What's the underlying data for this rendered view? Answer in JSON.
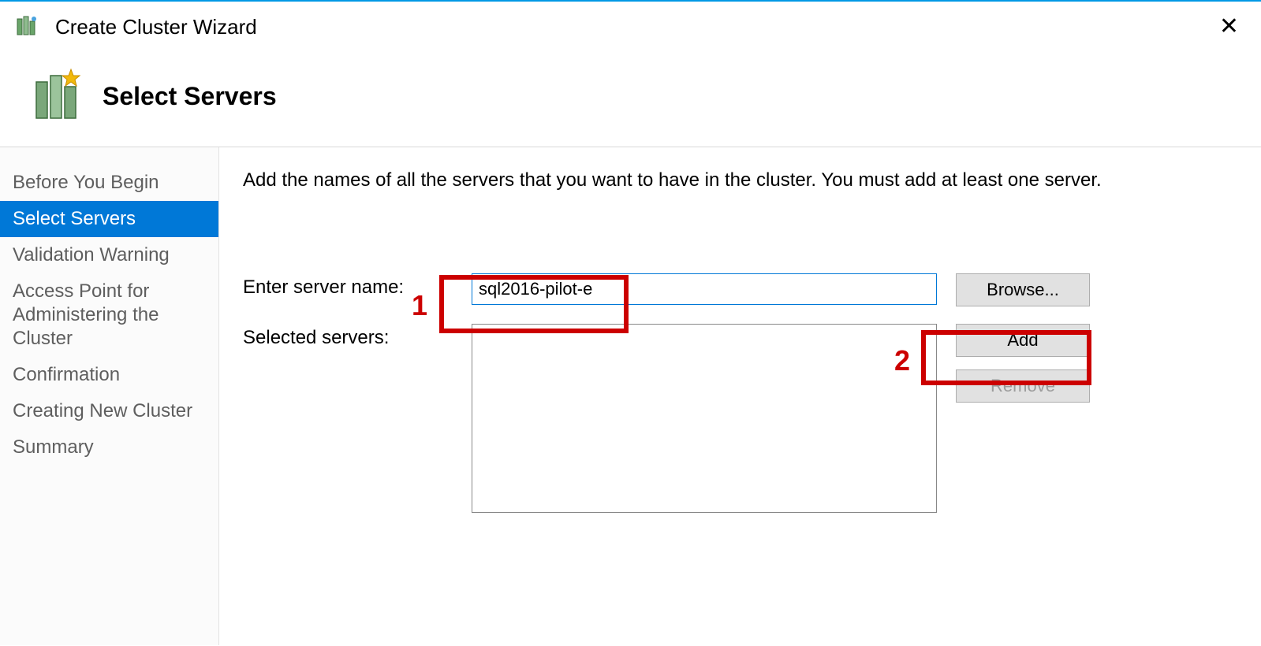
{
  "window": {
    "title": "Create Cluster Wizard"
  },
  "page": {
    "title": "Select Servers",
    "instruction": "Add the names of all the servers that you want to have in the cluster. You must add at least one server."
  },
  "sidebar": {
    "items": [
      {
        "label": "Before You Begin",
        "active": false
      },
      {
        "label": "Select Servers",
        "active": true
      },
      {
        "label": "Validation Warning",
        "active": false
      },
      {
        "label": "Access Point for Administering the Cluster",
        "active": false
      },
      {
        "label": "Confirmation",
        "active": false
      },
      {
        "label": "Creating New Cluster",
        "active": false
      },
      {
        "label": "Summary",
        "active": false
      }
    ]
  },
  "form": {
    "server_name_label": "Enter server name:",
    "server_name_value": "sql2016-pilot-e",
    "selected_servers_label": "Selected servers:",
    "browse_label": "Browse...",
    "add_label": "Add",
    "remove_label": "Remove"
  },
  "annotations": {
    "box1_label": "1",
    "box2_label": "2"
  }
}
